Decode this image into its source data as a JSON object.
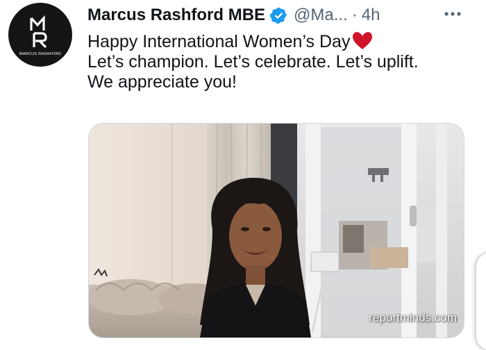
{
  "author": {
    "display_name": "Marcus Rashford MBE",
    "handle": "@Ma...",
    "separator": "·",
    "timestamp": "4h",
    "avatar_monogram": "MR",
    "avatar_caption": "MARCUS RASHFORD",
    "verified": true
  },
  "tweet": {
    "lines": [
      "Happy International Women’s Day",
      "Let’s champion. Let’s celebrate. Let’s uplift.",
      "We appreciate you!"
    ],
    "emoji": "red-heart-icon"
  },
  "media": {
    "watermark": "reportminds.com",
    "description_icon": "photo"
  },
  "colors": {
    "text_primary": "#0f1419",
    "text_secondary": "#536471",
    "verified_blue": "#1d9bf0",
    "heart_red": "#d0152b",
    "avatar_bg": "#141414"
  },
  "icons": {
    "verified": "verified-badge-icon",
    "more": "more-options-icon",
    "heart": "red-heart-icon"
  }
}
